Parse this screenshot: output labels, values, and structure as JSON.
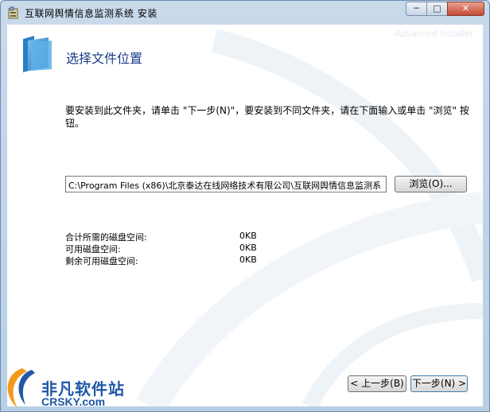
{
  "window": {
    "title": "互联网舆情信息监测系统 安装",
    "minimize": "─",
    "maximize": "□",
    "close": "✕"
  },
  "brand_watermark": "Advanced Installer",
  "page": {
    "title": "选择文件位置",
    "instructions": "要安装到此文件夹，请单击 \"下一步(N)\"，要安装到不同文件夹，请在下面输入或单击 \"浏览\" 按钮。"
  },
  "path_input": {
    "value": "C:\\Program Files (x86)\\北京泰达在线网络技术有限公司\\互联网舆情信息监测系"
  },
  "buttons": {
    "browse": "浏览(O)...",
    "back": "< 上一步(B)",
    "next": "下一步(N) >"
  },
  "disk": [
    {
      "label": "合计所需的磁盘空间:",
      "value": "0KB"
    },
    {
      "label": "可用磁盘空间:",
      "value": "0KB"
    },
    {
      "label": "剩余可用磁盘空间:",
      "value": "0KB"
    }
  ],
  "logo": {
    "cn": "非凡软件站",
    "en": "CRSKY.com"
  },
  "colors": {
    "title_blue": "#1a3a8a",
    "logo_blue": "#1f57a5",
    "logo_orange": "#f29a1f"
  },
  "icons": [
    "installer-icon",
    "folder-icon"
  ]
}
